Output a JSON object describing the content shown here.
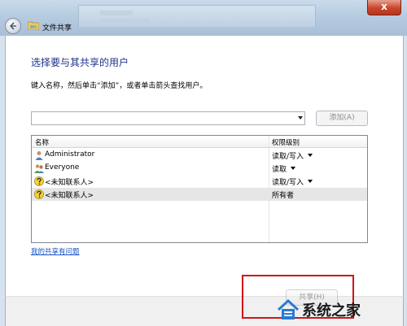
{
  "window": {
    "title": "文件共享",
    "close_label": "x",
    "accent": "#c9452b"
  },
  "main": {
    "heading": "选择要与其共享的用户",
    "instruction": "键入名称，然后单击“添加”，或者单击箭头查找用户。",
    "name_input": {
      "value": "",
      "placeholder": ""
    },
    "add_button": "添加(A)",
    "list": {
      "columns": [
        "名称",
        "权限级别"
      ],
      "rows": [
        {
          "name": "Administrator",
          "permission": "读取/写入",
          "has_dropdown": true,
          "icon": "user-icon"
        },
        {
          "name": "Everyone",
          "permission": "读取",
          "has_dropdown": true,
          "icon": "group-icon"
        },
        {
          "name": "<未知联系人>",
          "permission": "读取/写入",
          "has_dropdown": true,
          "icon": "unknown-contact-icon"
        },
        {
          "name": "<未知联系人>",
          "permission": "所有者",
          "has_dropdown": false,
          "icon": "unknown-contact-icon",
          "selected": true
        }
      ]
    },
    "help_link": "我的共享有问题"
  },
  "footer": {
    "share_button": "共享(H)",
    "watermark": "系统之家"
  },
  "colors": {
    "heading": "#1e3287",
    "link": "#1a56c9",
    "highlight_box": "#d0141b"
  }
}
